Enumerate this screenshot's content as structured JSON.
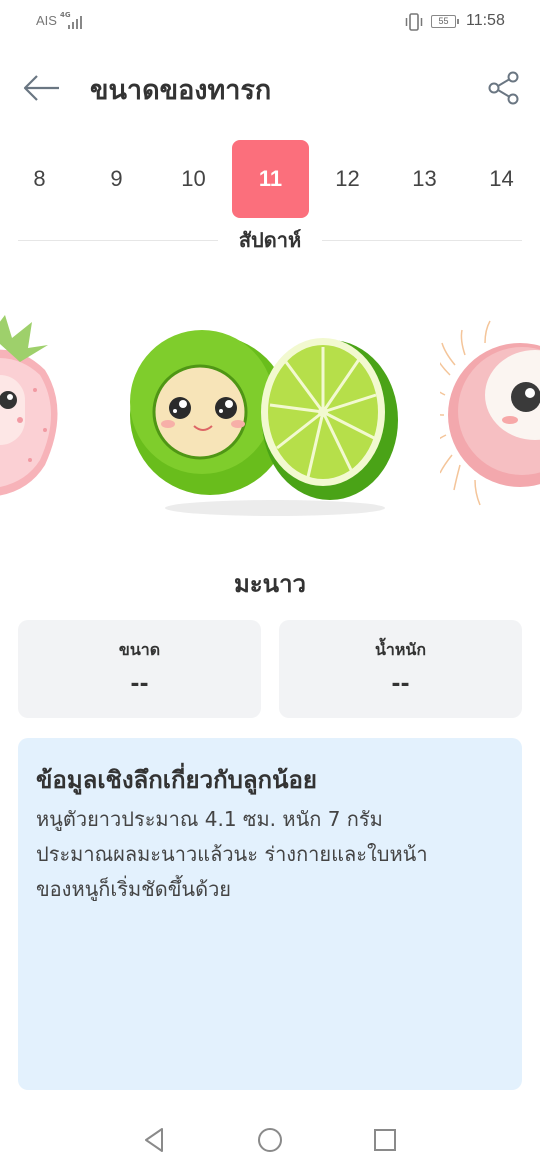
{
  "status": {
    "carrier": "AIS",
    "network": "4G",
    "battery": "55",
    "time": "11:58"
  },
  "header": {
    "title": "ขนาดของทารก",
    "back_icon": "arrow-left-icon",
    "share_icon": "share-icon"
  },
  "weeks": {
    "items": [
      "8",
      "9",
      "10",
      "11",
      "12",
      "13",
      "14"
    ],
    "selected": "11",
    "caption": "สัปดาห์",
    "accent": "#fb6f7c"
  },
  "fruit": {
    "name": "มะนาว",
    "left_icon": "strawberry-icon",
    "center_icon": "lime-icon",
    "right_icon": "rambutan-icon"
  },
  "stats": {
    "size_label": "ขนาด",
    "size_value": "--",
    "weight_label": "น้ำหนัก",
    "weight_value": "--"
  },
  "insight": {
    "title": "ข้อมูลเชิงลึกเกี่ยวกับลูกน้อย",
    "line1": "หนูตัวยาวประมาณ 4.1 ซม. หนัก 7 กรัม",
    "line2": "ประมาณผลมะนาวแล้วนะ ร่างกายและใบหน้า",
    "line3": "ของหนูก็เริ่มชัดขึ้นด้วย",
    "background": "#e3f1fd"
  },
  "navbar": {
    "back_icon": "nav-back-icon",
    "home_icon": "nav-home-icon",
    "recents_icon": "nav-recents-icon"
  }
}
